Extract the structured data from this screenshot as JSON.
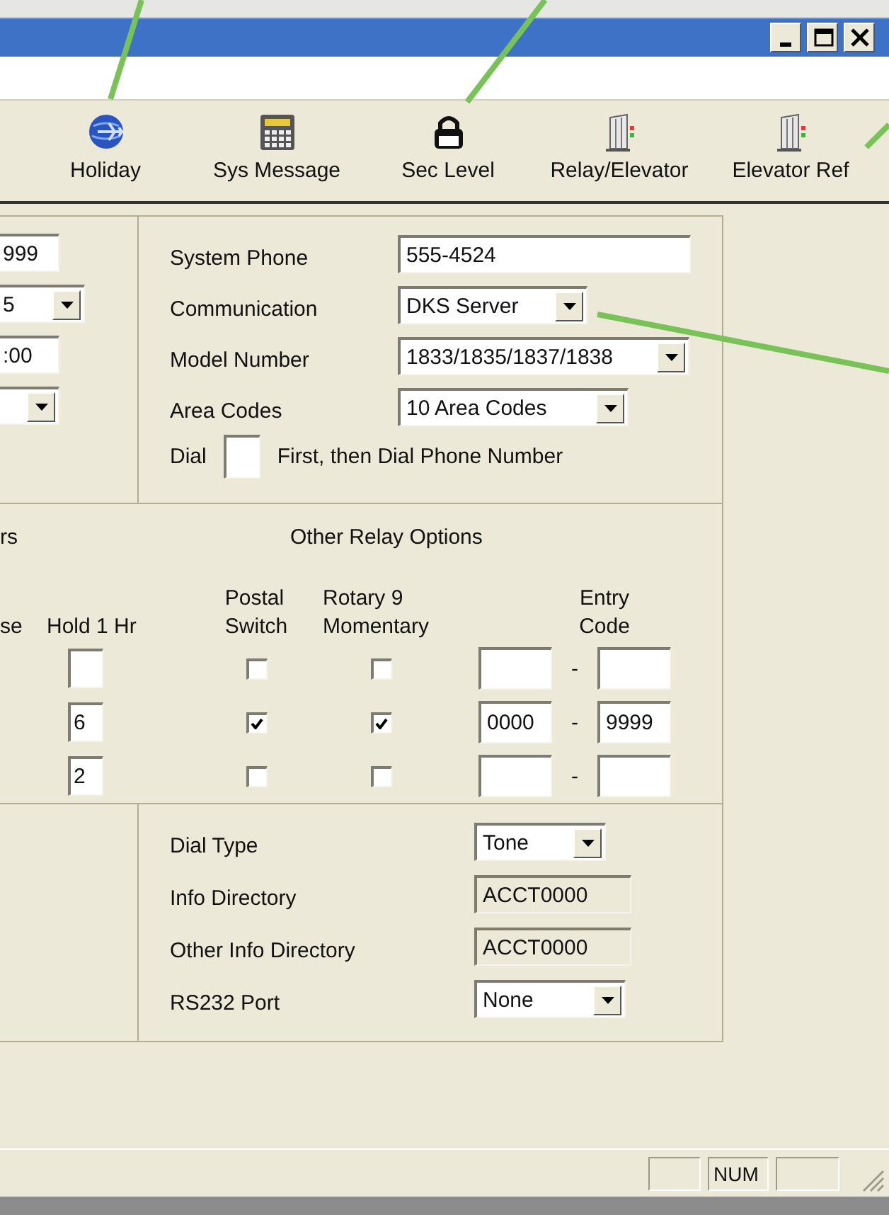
{
  "window": {
    "buttons": [
      {
        "kind": "minimize"
      },
      {
        "kind": "maximize"
      },
      {
        "kind": "close"
      }
    ]
  },
  "toolbar": [
    {
      "label": "Holiday",
      "kind": "globe"
    },
    {
      "label": "Sys Message",
      "kind": "calculator"
    },
    {
      "label": "Sec Level",
      "kind": "lock"
    },
    {
      "label": "Relay/Elevator",
      "kind": "elevator"
    },
    {
      "label": "Elevator Ref",
      "kind": "elevator"
    }
  ],
  "left_fields": [
    {
      "kind": "text",
      "value": "999"
    },
    {
      "kind": "select",
      "value": "5"
    },
    {
      "kind": "text",
      "value": ":00"
    },
    {
      "kind": "select"
    }
  ],
  "phone_settings": [
    {
      "label": "System Phone",
      "kind": "text",
      "value": "555-4524"
    },
    {
      "label": "Communication",
      "kind": "select",
      "value": "DKS Server"
    },
    {
      "label": "Model Number",
      "kind": "select",
      "value": "1833/1835/1837/1838"
    },
    {
      "label": "Area Codes",
      "kind": "select",
      "value": "10 Area Codes"
    }
  ],
  "dial_prefix": {
    "before": "Dial",
    "after": "First, then Dial Phone Number"
  },
  "relays": {
    "heading": "rs",
    "title": "Other Relay Options",
    "columns": [
      "se",
      "Hold 1 Hr",
      "Postal\nSwitch",
      "Rotary 9\nMomentary",
      "Entry\nCode"
    ],
    "rows": [
      {
        "postal_switch": false,
        "rotary_momentary": false,
        "separator": "-"
      },
      {
        "hold": "6",
        "postal_switch": true,
        "rotary_momentary": true,
        "entry_from": "0000",
        "separator": "-",
        "entry_to": "9999"
      },
      {
        "hold": "2",
        "postal_switch": false,
        "rotary_momentary": false,
        "separator": "-"
      }
    ]
  },
  "dial_settings": [
    {
      "label": "Dial Type",
      "kind": "select",
      "value": "Tone"
    },
    {
      "label": "Info Directory",
      "kind": "readonly",
      "value": "ACCT0000"
    },
    {
      "label": "Other Info Directory",
      "kind": "readonly",
      "value": "ACCT0000"
    },
    {
      "label": "RS232 Port",
      "kind": "select",
      "value": "None"
    }
  ],
  "status_bar": [
    {
      "kind": "empty"
    },
    {
      "kind": "text",
      "text": "NUM"
    },
    {
      "kind": "empty"
    }
  ]
}
